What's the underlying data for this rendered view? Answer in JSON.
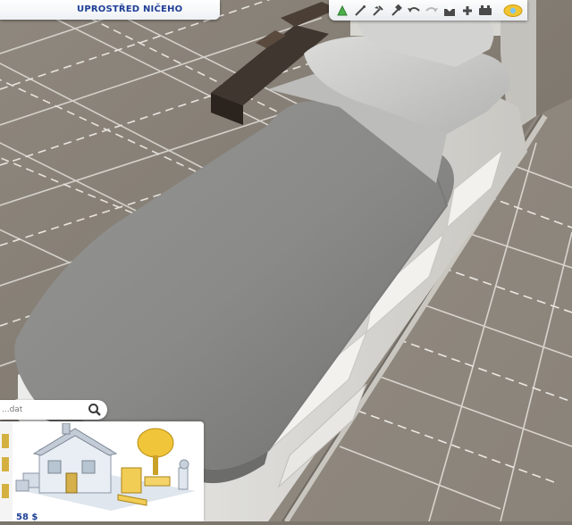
{
  "lot": {
    "name": "UPROSTŘED NIČEHO"
  },
  "toolbar": {
    "tools": [
      {
        "icon": "build-mode-icon",
        "color": "#4bb04a"
      },
      {
        "icon": "wand-icon",
        "color": "#4a4a4a"
      },
      {
        "icon": "eyedropper-icon",
        "color": "#4a4a4a"
      },
      {
        "icon": "sledgehammer-icon",
        "color": "#4a4a4a"
      },
      {
        "icon": "undo-icon",
        "color": "#4a4a4a"
      },
      {
        "icon": "redo-icon",
        "color": "#b8b8b8"
      },
      {
        "icon": "save-icon",
        "color": "#4a4a4a"
      },
      {
        "icon": "add-icon",
        "color": "#4a4a4a"
      },
      {
        "icon": "settings-icon",
        "color": "#4a4a4a"
      },
      {
        "icon": "camera-view-icon",
        "color": "#f2c531"
      }
    ]
  },
  "catalog": {
    "search_placeholder": "...dat",
    "funds": "58 $"
  },
  "colors": {
    "accent": "#1f3f96",
    "floor": "#8c857b",
    "floor_grout": "#d9d6d0",
    "blanket": "#8b8b89",
    "pillow": "#cfcfcf",
    "bed_frame": "#d6d4cf"
  }
}
